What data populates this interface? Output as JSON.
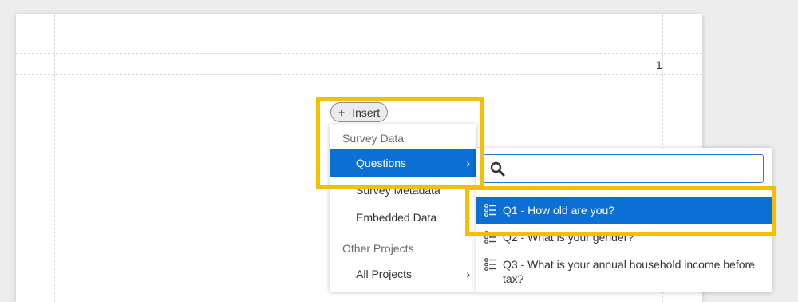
{
  "page": {
    "page_number": "1"
  },
  "insert_button": {
    "label": "Insert"
  },
  "insert_menu": {
    "survey_data_header": "Survey Data",
    "items": [
      {
        "label": "Questions"
      },
      {
        "label": "Survey Metadata"
      },
      {
        "label": "Embedded Data"
      }
    ],
    "other_projects_header": "Other Projects",
    "other_items": [
      {
        "label": "All Projects"
      }
    ]
  },
  "questions_submenu": {
    "search": {
      "value": "",
      "placeholder": ""
    },
    "questions": [
      {
        "label": "Q1 - How old are you?"
      },
      {
        "label": "Q2 - What is your gender?"
      },
      {
        "label": "Q3 - What is your annual household income before tax?"
      }
    ]
  },
  "colors": {
    "accent_blue": "#0b6fd3",
    "highlight_yellow": "#f5be00"
  }
}
